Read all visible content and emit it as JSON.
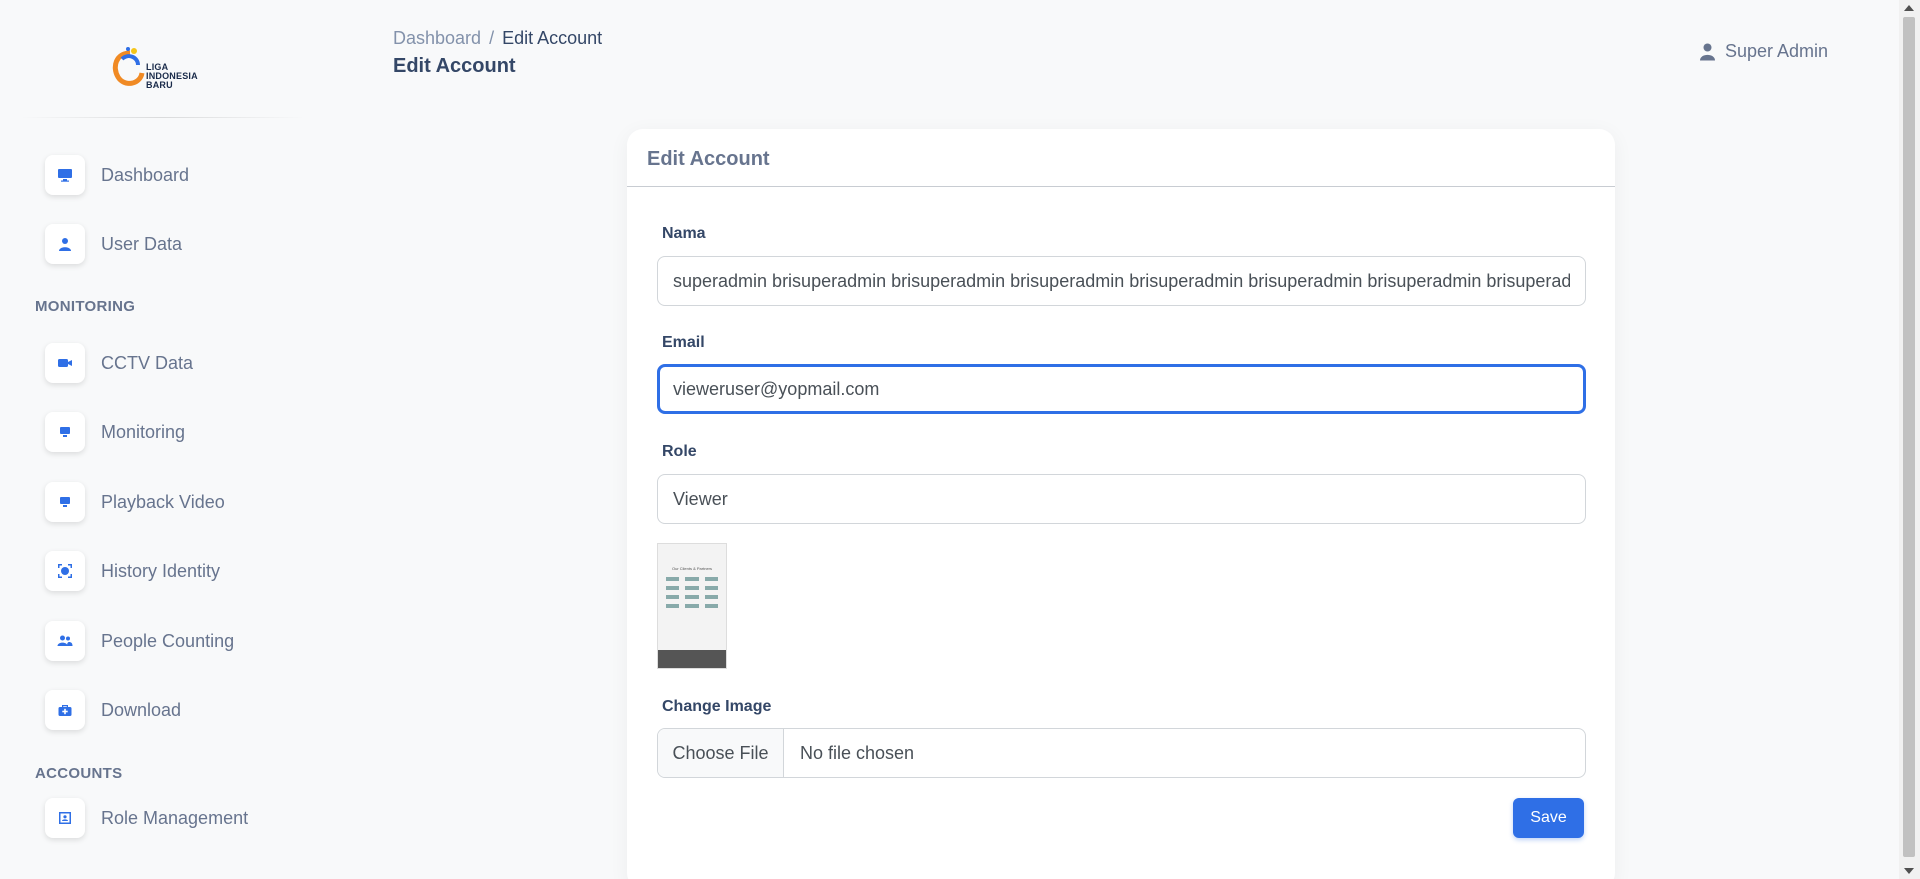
{
  "logo": {
    "line1": "LIGA",
    "line2": "INDONESIA",
    "line3": "BARU"
  },
  "sidebar": {
    "items": [
      {
        "label": "Dashboard",
        "icon": "monitor-icon"
      },
      {
        "label": "User Data",
        "icon": "user-icon"
      }
    ],
    "monitoring_section": "MONITORING",
    "monitoring_items": [
      {
        "label": "CCTV Data",
        "icon": "video-camera-icon"
      },
      {
        "label": "Monitoring",
        "icon": "desktop-icon"
      },
      {
        "label": "Playback Video",
        "icon": "desktop-icon"
      },
      {
        "label": "History Identity",
        "icon": "face-scan-icon"
      },
      {
        "label": "People Counting",
        "icon": "users-icon"
      },
      {
        "label": "Download",
        "icon": "briefcase-medical-icon"
      }
    ],
    "accounts_section": "ACCOUNTS",
    "accounts_items": [
      {
        "label": "Role Management",
        "icon": "id-card-icon"
      }
    ]
  },
  "header": {
    "breadcrumb_root": "Dashboard",
    "breadcrumb_separator": "/",
    "breadcrumb_current": "Edit Account",
    "page_title": "Edit Account",
    "user_name": "Super Admin"
  },
  "form": {
    "card_title": "Edit Account",
    "name_label": "Nama",
    "name_value": "superadmin brisuperadmin brisuperadmin brisuperadmin brisuperadmin brisuperadmin brisuperadmin brisuperadmin brisu",
    "email_label": "Email",
    "email_value": "vieweruser@yopmail.com",
    "role_label": "Role",
    "role_value": "Viewer",
    "preview_caption": "Our Clients & Partners",
    "change_image_label": "Change Image",
    "choose_file_label": "Choose File",
    "file_status": "No file chosen",
    "save_label": "Save"
  },
  "colors": {
    "accent": "#2f6fe6",
    "text": "#344767",
    "muted": "#67748e"
  }
}
